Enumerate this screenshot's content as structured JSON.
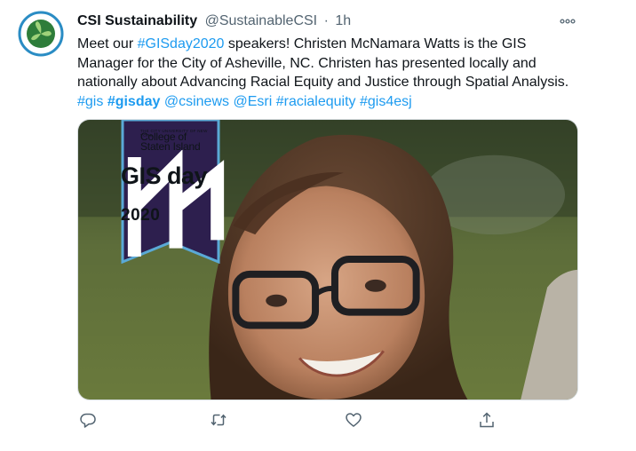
{
  "tweet": {
    "author_name": "CSI Sustainability",
    "author_handle": "@SustainableCSI",
    "separator": "·",
    "timestamp": "1h",
    "text_segments": [
      {
        "type": "text",
        "value": "Meet our "
      },
      {
        "type": "link",
        "value": "#GISday2020"
      },
      {
        "type": "text",
        "value": " speakers! Christen McNamara Watts is the GIS Manager for the City of Asheville, NC. Christen has presented locally and nationally about Advancing Racial Equity and Justice through Spatial Analysis. "
      },
      {
        "type": "link",
        "value": "#gis"
      },
      {
        "type": "text",
        "value": " "
      },
      {
        "type": "link-bold",
        "value": "#gisday"
      },
      {
        "type": "text",
        "value": " "
      },
      {
        "type": "link",
        "value": "@csinews"
      },
      {
        "type": "text",
        "value": " "
      },
      {
        "type": "link",
        "value": "@Esri"
      },
      {
        "type": "text",
        "value": " "
      },
      {
        "type": "link",
        "value": "#racialequity"
      },
      {
        "type": "text",
        "value": " "
      },
      {
        "type": "link",
        "value": "#gis4esj"
      }
    ],
    "media": {
      "banner_university": "THE CITY UNIVERSITY OF NEW YORK",
      "banner_college": "College of Staten Island",
      "banner_gis": "GIS day",
      "banner_year": "2020"
    },
    "actions": {
      "reply_icon": "reply-icon",
      "retweet_icon": "retweet-icon",
      "like_icon": "heart-icon",
      "share_icon": "share-icon"
    }
  },
  "colors": {
    "link": "#1d9bf0",
    "secondary_text": "#536471",
    "banner_navy": "#2d1f4e",
    "banner_border": "#5aa9d6"
  }
}
